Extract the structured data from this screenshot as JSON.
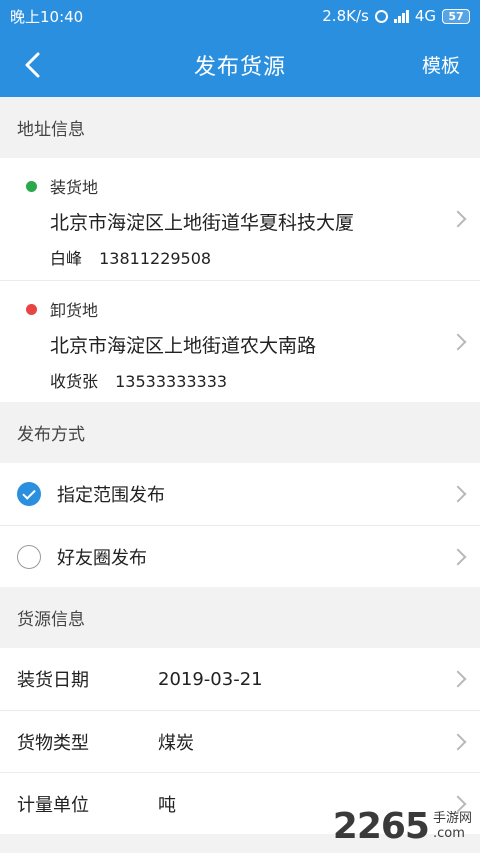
{
  "statusbar": {
    "time": "晚上10:40",
    "net_speed": "2.8K/s",
    "network_type": "4G",
    "battery": "57"
  },
  "navbar": {
    "title": "发布货源",
    "right_label": "模板",
    "back_icon": "chevron-left-icon"
  },
  "address_section": {
    "header": "地址信息",
    "loading": {
      "type_label": "装货地",
      "dot_color": "#2aa84a",
      "address": "北京市海淀区上地街道华夏科技大厦",
      "contact_name": "白峰",
      "contact_phone": "13811229508"
    },
    "unloading": {
      "type_label": "卸货地",
      "dot_color": "#e84444",
      "address": "北京市海淀区上地街道农大南路",
      "contact_name": "收货张",
      "contact_phone": "13533333333"
    }
  },
  "publish_section": {
    "header": "发布方式",
    "options": [
      {
        "label": "指定范围发布",
        "checked": true
      },
      {
        "label": "好友圈发布",
        "checked": false
      }
    ]
  },
  "cargo_section": {
    "header": "货源信息",
    "rows": [
      {
        "label": "装货日期",
        "value": "2019-03-21"
      },
      {
        "label": "货物类型",
        "value": "煤炭"
      },
      {
        "label": "计量单位",
        "value": "吨"
      }
    ]
  },
  "watermark": {
    "number": "2265",
    "suffix": "手游网",
    "domain": ".com"
  },
  "colors": {
    "primary": "#2b8fe0",
    "background": "#f2f2f2"
  }
}
